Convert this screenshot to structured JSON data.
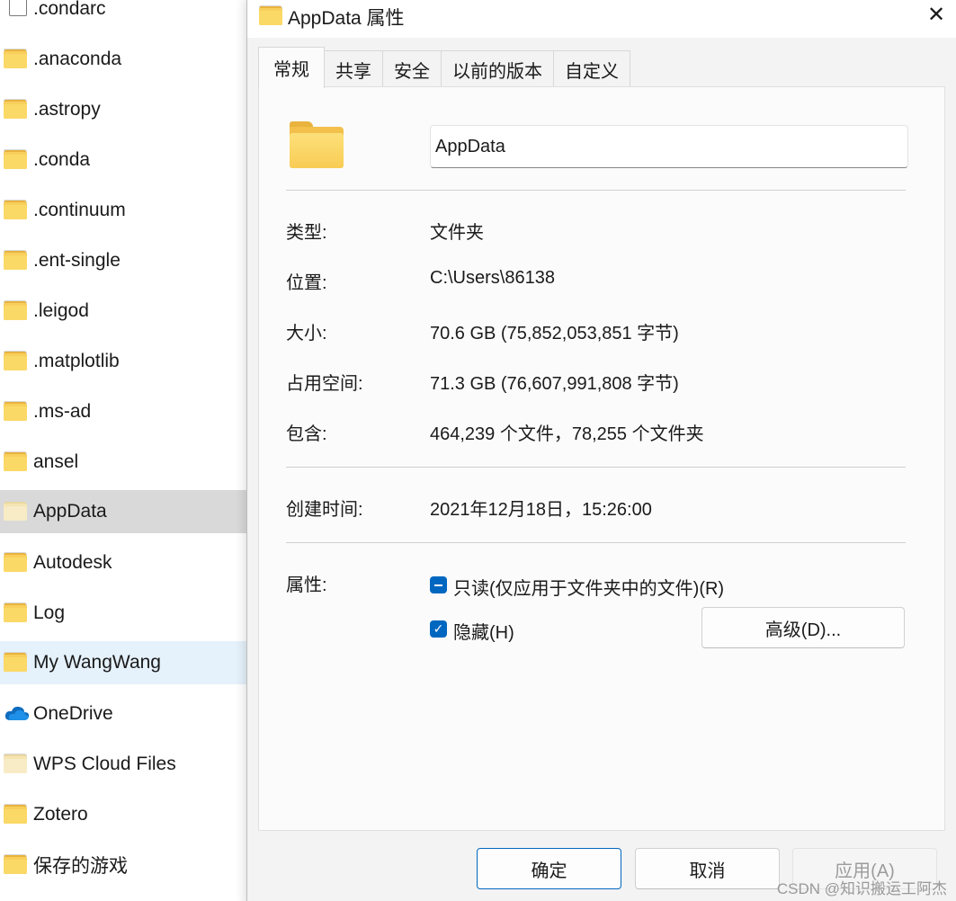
{
  "explorer": {
    "items": [
      {
        "name": ".condarc",
        "icon": "file-icon"
      },
      {
        "name": ".anaconda",
        "icon": "folder-icon"
      },
      {
        "name": ".astropy",
        "icon": "folder-icon"
      },
      {
        "name": ".conda",
        "icon": "folder-icon"
      },
      {
        "name": ".continuum",
        "icon": "folder-icon"
      },
      {
        "name": ".ent-single",
        "icon": "folder-icon"
      },
      {
        "name": ".leigod",
        "icon": "folder-icon"
      },
      {
        "name": ".matplotlib",
        "icon": "folder-icon"
      },
      {
        "name": ".ms-ad",
        "icon": "folder-icon"
      },
      {
        "name": "ansel",
        "icon": "folder-icon"
      },
      {
        "name": "AppData",
        "icon": "folder-icon"
      },
      {
        "name": "Autodesk",
        "icon": "folder-icon"
      },
      {
        "name": "Log",
        "icon": "folder-icon"
      },
      {
        "name": "My WangWang",
        "icon": "folder-icon"
      },
      {
        "name": "OneDrive",
        "icon": "cloud-icon"
      },
      {
        "name": "WPS Cloud Files",
        "icon": "folder-icon"
      },
      {
        "name": "Zotero",
        "icon": "folder-icon"
      },
      {
        "name": "保存的游戏",
        "icon": "folder-icon"
      }
    ]
  },
  "dialog": {
    "title": "AppData 属性",
    "close_glyph": "✕",
    "tabs": [
      "常规",
      "共享",
      "安全",
      "以前的版本",
      "自定义"
    ],
    "name_value": "AppData",
    "props": {
      "type_label": "类型:",
      "type_value": "文件夹",
      "location_label": "位置:",
      "location_value": "C:\\Users\\86138",
      "size_label": "大小:",
      "size_value": "70.6 GB (75,852,053,851 字节)",
      "disk_label": "占用空间:",
      "disk_value": "71.3 GB (76,607,991,808 字节)",
      "contains_label": "包含:",
      "contains_value": "464,239 个文件，78,255 个文件夹",
      "created_label": "创建时间:",
      "created_value": "2021年12月18日，15:26:00",
      "attributes_label": "属性:",
      "readonly_label": "只读(仅应用于文件夹中的文件)(R)",
      "hidden_label": "隐藏(H)",
      "advanced_label": "高级(D)..."
    },
    "buttons": {
      "ok": "确定",
      "cancel": "取消",
      "apply": "应用(A)"
    }
  },
  "watermark": "CSDN @知识搬运工阿杰",
  "colors": {
    "accent": "#0067c0",
    "folder": "#f8cf5b",
    "selected_row": "#d9d9d9",
    "hover_row": "#e5f1fb"
  }
}
